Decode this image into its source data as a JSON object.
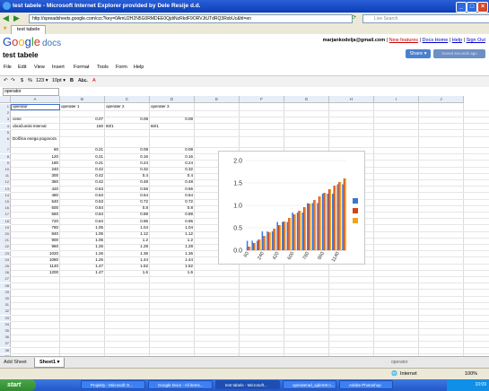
{
  "window": {
    "title": "test tabele - Microsoft Internet Explorer provided by Dele Resije d.d."
  },
  "browser": {
    "address_label": "Address",
    "address": "http://spreadsheets.google.com/ccc?key=0AmU2H2N5G0RMDEE0QjdiNzRkdF9ORVJtUTdRQ3RxbUc&hl=en",
    "search_placeholder": "Live Search",
    "tab_title": "test tabele"
  },
  "docs": {
    "logo_google": [
      "G",
      "o",
      "o",
      "g",
      "l",
      "e"
    ],
    "logo_docs": "docs",
    "user": "marjankodelja@gmail.com",
    "links": [
      "New features",
      "Docs Home",
      "Help",
      "Sign Out"
    ],
    "doc_title": "test tabele",
    "share_label": "Share ▾",
    "save_label": "Saved seconds ago",
    "menu": [
      "File",
      "Edit",
      "View",
      "Insert",
      "Format",
      "Tools",
      "Form",
      "Help"
    ]
  },
  "toolbar": {
    "undo": "↶",
    "redo": "↷",
    "currency": "$",
    "percent": "%",
    "numfmt": "123 ▾",
    "fontsize": "10pt ▾",
    "bold": "B",
    "strike": "A̶b̶c̶",
    "textcolor": "A"
  },
  "formula": {
    "cellref": "operator"
  },
  "columns": [
    "A",
    "B",
    "C",
    "D",
    "E",
    "F",
    "G",
    "H",
    "I",
    "J"
  ],
  "rows": [
    {
      "n": "1",
      "a": "operator",
      "b": "operater 1",
      "c": "operater 2",
      "d": "operater 3"
    },
    {
      "n": "2",
      "a": "",
      "b": "",
      "c": "",
      "d": ""
    },
    {
      "n": "3",
      "a": "cene",
      "b": "0.07",
      "c": "0.08",
      "d": "0.08"
    },
    {
      "n": "4",
      "a": "obračunski interval",
      "b": "160",
      "b2": "60/1",
      "c": "",
      "d": "60/1"
    },
    {
      "n": "5",
      "a": "",
      "b": "",
      "c": "",
      "d": ""
    },
    {
      "n": "6",
      "a": "Dolžina enega pogovora",
      "b": "",
      "c": "",
      "d": ""
    },
    {
      "n": "7",
      "a": "60",
      "b": "0.21",
      "c": "0.08",
      "d": "0.08"
    },
    {
      "n": "8",
      "a": "120",
      "b": "0.21",
      "c": "0.16",
      "d": "0.16"
    },
    {
      "n": "9",
      "a": "180",
      "b": "0.21",
      "c": "0.24",
      "d": "0.24"
    },
    {
      "n": "10",
      "a": "240",
      "b": "0.42",
      "c": "0.32",
      "d": "0.32"
    },
    {
      "n": "11",
      "a": "300",
      "b": "0.42",
      "c": "0.4",
      "d": "0.4"
    },
    {
      "n": "12",
      "a": "360",
      "b": "0.42",
      "c": "0.48",
      "d": "0.48"
    },
    {
      "n": "13",
      "a": "420",
      "b": "0.63",
      "c": "0.56",
      "d": "0.56"
    },
    {
      "n": "14",
      "a": "480",
      "b": "0.63",
      "c": "0.64",
      "d": "0.64"
    },
    {
      "n": "15",
      "a": "540",
      "b": "0.63",
      "c": "0.72",
      "d": "0.72"
    },
    {
      "n": "16",
      "a": "600",
      "b": "0.84",
      "c": "0.8",
      "d": "0.8"
    },
    {
      "n": "17",
      "a": "660",
      "b": "0.84",
      "c": "0.88",
      "d": "0.88"
    },
    {
      "n": "18",
      "a": "720",
      "b": "0.84",
      "c": "0.96",
      "d": "0.96"
    },
    {
      "n": "19",
      "a": "780",
      "b": "1.05",
      "c": "1.04",
      "d": "1.04"
    },
    {
      "n": "20",
      "a": "840",
      "b": "1.05",
      "c": "1.12",
      "d": "1.12"
    },
    {
      "n": "21",
      "a": "900",
      "b": "1.05",
      "c": "1.2",
      "d": "1.2"
    },
    {
      "n": "22",
      "a": "960",
      "b": "1.26",
      "c": "1.28",
      "d": "1.28"
    },
    {
      "n": "23",
      "a": "1020",
      "b": "1.26",
      "c": "1.36",
      "d": "1.36"
    },
    {
      "n": "24",
      "a": "1080",
      "b": "1.26",
      "c": "1.44",
      "d": "1.44"
    },
    {
      "n": "25",
      "a": "1140",
      "b": "1.47",
      "c": "1.52",
      "d": "1.52"
    },
    {
      "n": "26",
      "a": "1200",
      "b": "1.47",
      "c": "1.6",
      "d": "1.6"
    },
    {
      "n": "27"
    },
    {
      "n": "28"
    },
    {
      "n": "29"
    },
    {
      "n": "30"
    },
    {
      "n": "31"
    },
    {
      "n": "32"
    },
    {
      "n": "33"
    },
    {
      "n": "34"
    },
    {
      "n": "35"
    },
    {
      "n": "36"
    },
    {
      "n": "37"
    },
    {
      "n": "38"
    },
    {
      "n": "39"
    },
    {
      "n": "40"
    }
  ],
  "chart_data": {
    "type": "bar",
    "categories": [
      "60",
      "120",
      "180",
      "240",
      "300",
      "360",
      "420",
      "480",
      "540",
      "600",
      "660",
      "720",
      "780",
      "840",
      "900",
      "960",
      "1020",
      "1080",
      "1140",
      "1200"
    ],
    "x_tick_labels": [
      "60",
      "240",
      "420",
      "600",
      "780",
      "960",
      "1140"
    ],
    "series": [
      {
        "values": [
          0.21,
          0.21,
          0.21,
          0.42,
          0.42,
          0.42,
          0.63,
          0.63,
          0.63,
          0.84,
          0.84,
          0.84,
          1.05,
          1.05,
          1.05,
          1.26,
          1.26,
          1.26,
          1.47,
          1.47
        ],
        "color": "#3a76d6"
      },
      {
        "values": [
          0.08,
          0.16,
          0.24,
          0.32,
          0.4,
          0.48,
          0.56,
          0.64,
          0.72,
          0.8,
          0.88,
          0.96,
          1.04,
          1.12,
          1.2,
          1.28,
          1.36,
          1.44,
          1.52,
          1.6
        ],
        "color": "#d2441b"
      },
      {
        "values": [
          0.08,
          0.16,
          0.24,
          0.32,
          0.4,
          0.48,
          0.56,
          0.64,
          0.72,
          0.8,
          0.88,
          0.96,
          1.04,
          1.12,
          1.2,
          1.28,
          1.36,
          1.44,
          1.52,
          1.6
        ],
        "color": "#f0a21d"
      }
    ],
    "yticks": [
      "0.0",
      "0.5",
      "1.0",
      "1.5",
      "2.0"
    ],
    "ylim": [
      0,
      2.0
    ],
    "legend": "right"
  },
  "sheets": {
    "add_label": "Add Sheet",
    "active": "Sheet1 ▾",
    "status_right": "operator"
  },
  "iestatus": {
    "zone": "Internet",
    "zoom": "100%"
  },
  "taskbar": {
    "start": "start",
    "tasks": [
      "Projekty - Microsoft O...",
      "Google Docs - All items...",
      "test tabele - Microsoft...",
      "operaterad_ajdem8 n...",
      "Adobe Photoshop"
    ],
    "clock": "10:09"
  }
}
